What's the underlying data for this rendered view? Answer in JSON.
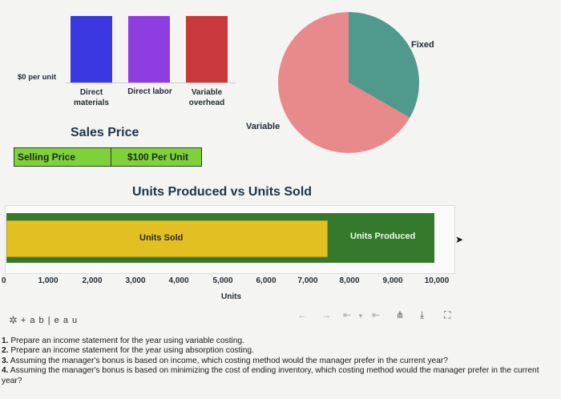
{
  "top_chart": {
    "cut_label": "",
    "zero_label": "$0 per unit",
    "categories": [
      "Direct materials",
      "Direct labor",
      "Variable overhead"
    ],
    "category_lines": [
      [
        "Direct",
        "materials"
      ],
      [
        "Direct labor"
      ],
      [
        "Variable",
        "overhead"
      ]
    ],
    "bar_colors": [
      "#3b37e0",
      "#8e3ee0",
      "#c9383a"
    ]
  },
  "pie": {
    "labels": [
      "Fixed",
      "Variable"
    ],
    "shares": [
      0.333,
      0.667
    ],
    "colors": [
      "#4f9a8d",
      "#e88a8b"
    ]
  },
  "sales_price": {
    "title": "Sales Price",
    "label": "Selling Price",
    "value": "$100 Per Unit"
  },
  "units_chart": {
    "title": "Units Produced vs Units Sold",
    "sold_label": "Units Sold",
    "produced_label": "Units Produced",
    "axis_label": "Units",
    "ticks": [
      "0",
      "1,000",
      "2,000",
      "3,000",
      "4,000",
      "5,000",
      "6,000",
      "7,000",
      "8,000",
      "9,000",
      "10,000"
    ]
  },
  "chart_data": [
    {
      "type": "bar",
      "title": "Units Produced vs Units Sold",
      "xlabel": "Units",
      "xlim": [
        0,
        10000
      ],
      "orientation": "horizontal",
      "series": [
        {
          "name": "Units Produced",
          "values": [
            10000
          ],
          "color": "#357a2c"
        },
        {
          "name": "Units Sold",
          "values": [
            7500
          ],
          "color": "#e3c021"
        }
      ]
    },
    {
      "type": "pie",
      "categories": [
        "Fixed",
        "Variable"
      ],
      "values": [
        33.3,
        66.7
      ]
    }
  ],
  "footer": {
    "brand": "+ a b | e a u",
    "icons": [
      "undo-icon",
      "redo-icon",
      "revert-icon",
      "reset-icon",
      "share-icon",
      "download-icon",
      "fullscreen-icon"
    ]
  },
  "questions": [
    {
      "num": "1.",
      "text": "Prepare an income statement for the year using variable costing."
    },
    {
      "num": "2.",
      "text": "Prepare an income statement for the year using absorption costing."
    },
    {
      "num": "3.",
      "text": "Assuming the manager's bonus is based on income, which costing method would the manager prefer in the current year?"
    },
    {
      "num": "4.",
      "text": "Assuming the manager's bonus is based on minimizing the cost of ending inventory, which costing method would the manager prefer in the current year?"
    }
  ]
}
